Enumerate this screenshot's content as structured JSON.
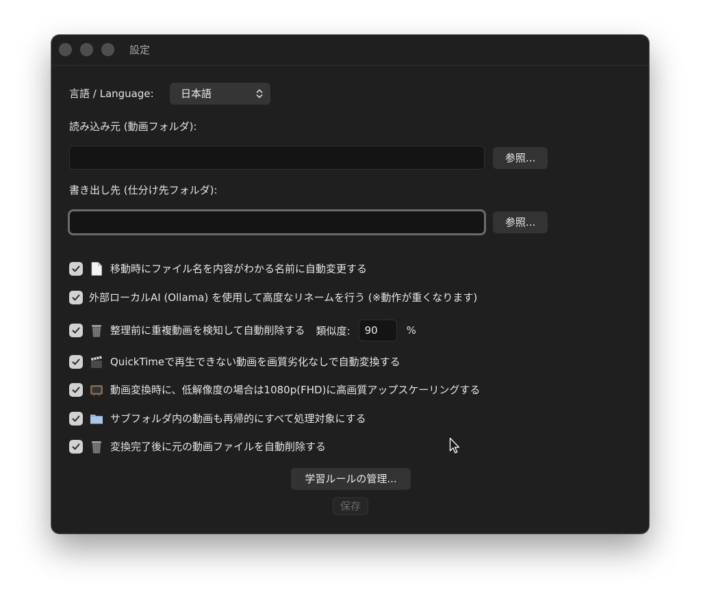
{
  "window": {
    "title": "設定"
  },
  "language": {
    "label": "言語 / Language:",
    "selected": "日本語"
  },
  "source": {
    "label": "読み込み元 (動画フォルダ):",
    "value": "",
    "browse_label": "参照..."
  },
  "destination": {
    "label": "書き出し先 (仕分け先フォルダ):",
    "value": "",
    "browse_label": "参照..."
  },
  "options": [
    {
      "checked": true,
      "icon": "document-icon",
      "label": "移動時にファイル名を内容がわかる名前に自動変更する"
    },
    {
      "checked": true,
      "icon": "",
      "label": "外部ローカルAI (Ollama) を使用して高度なリネームを行う (※動作が重くなります)"
    },
    {
      "checked": true,
      "icon": "wastebasket-icon",
      "label": "整理前に重複動画を検知して自動削除する"
    },
    {
      "checked": true,
      "icon": "clapper-board-icon",
      "label": "QuickTimeで再生できない動画を画質劣化なしで自動変換する"
    },
    {
      "checked": true,
      "icon": "television-icon",
      "label": "動画変換時に、低解像度の場合は1080p(FHD)に高画質アップスケーリングする"
    },
    {
      "checked": true,
      "icon": "folder-icon",
      "label": "サブフォルダ内の動画も再帰的にすべて処理対象にする"
    },
    {
      "checked": true,
      "icon": "wastebasket-icon",
      "label": "変換完了後に元の動画ファイルを自動削除する"
    }
  ],
  "similarity": {
    "label": "類似度:",
    "value": "90",
    "unit": "%"
  },
  "buttons": {
    "manage_rules": "学習ルールの管理...",
    "save": "保存"
  },
  "colors": {
    "window_bg": "#1f1f1f",
    "checkbox": "#d2d2d2",
    "button": "#333333"
  }
}
